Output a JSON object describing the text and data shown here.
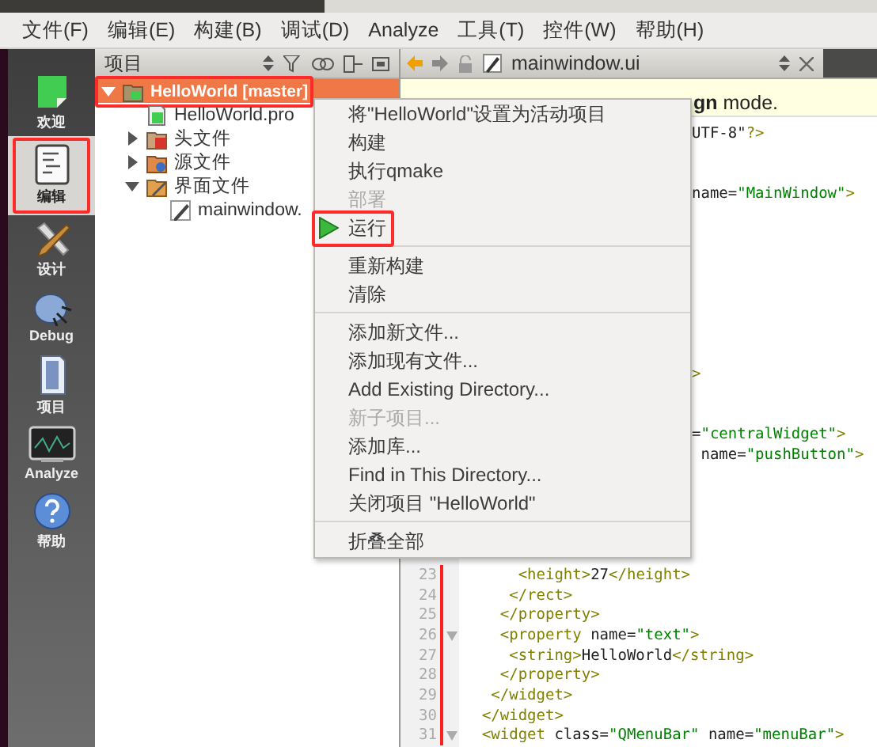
{
  "menubar": {
    "items": [
      "文件(F)",
      "编辑(E)",
      "构建(B)",
      "调试(D)",
      "Analyze",
      "工具(T)",
      "控件(W)",
      "帮助(H)"
    ]
  },
  "modes": [
    {
      "label": "欢迎",
      "kind": "welcome",
      "selected": false,
      "outlined": false
    },
    {
      "label": "编辑",
      "kind": "edit",
      "selected": true,
      "outlined": true
    },
    {
      "label": "设计",
      "kind": "design",
      "selected": false,
      "outlined": false
    },
    {
      "label": "Debug",
      "kind": "debug",
      "selected": false,
      "outlined": false
    },
    {
      "label": "项目",
      "kind": "projects",
      "selected": false,
      "outlined": false
    },
    {
      "label": "Analyze",
      "kind": "analyze",
      "selected": false,
      "outlined": false
    },
    {
      "label": "帮助",
      "kind": "help",
      "selected": false,
      "outlined": false
    }
  ],
  "project_panel": {
    "title": "项目",
    "tree": [
      {
        "label": "HelloWorld [master]",
        "kind": "project",
        "expanded": true,
        "selected": true,
        "outlined": true,
        "children": [
          {
            "label": "HelloWorld.pro",
            "kind": "pro",
            "selected": false,
            "outlined": false
          },
          {
            "label": "头文件",
            "kind": "headers",
            "expanded": false,
            "selected": false,
            "outlined": false
          },
          {
            "label": "源文件",
            "kind": "sources",
            "expanded": false,
            "selected": false,
            "outlined": false
          },
          {
            "label": "界面文件",
            "kind": "forms",
            "expanded": true,
            "selected": false,
            "outlined": false,
            "children": [
              {
                "label": "mainwindow.",
                "kind": "form",
                "selected": false,
                "outlined": false
              }
            ]
          }
        ]
      }
    ]
  },
  "editor": {
    "tab": {
      "title": "mainwindow.ui"
    },
    "info_bar": {
      "text": "**gn** mode."
    },
    "lines": [
      {
        "kind": "fragment",
        "segments": [
          {
            "kind": "plain",
            "text": "UTF-8\""
          },
          {
            "kind": "tag",
            "text": "?>"
          }
        ]
      },
      {
        "kind": "covered"
      },
      {
        "kind": "covered"
      },
      {
        "kind": "fragment",
        "segments": [
          {
            "kind": "plain",
            "text": "name="
          },
          {
            "kind": "value",
            "text": "\"MainWindow\""
          },
          {
            "kind": "tag",
            "text": ">"
          }
        ]
      },
      {
        "kind": "covered"
      },
      {
        "kind": "covered"
      },
      {
        "kind": "covered"
      },
      {
        "kind": "covered"
      },
      {
        "kind": "covered"
      },
      {
        "kind": "covered"
      },
      {
        "kind": "covered"
      },
      {
        "kind": "covered"
      },
      {
        "kind": "fragment",
        "segments": [
          {
            "kind": "tag",
            "text": ">"
          }
        ]
      },
      {
        "kind": "covered"
      },
      {
        "kind": "covered"
      },
      {
        "kind": "fragment",
        "segments": [
          {
            "kind": "plain",
            "text": "="
          },
          {
            "kind": "value",
            "text": "\"centralWidget\""
          },
          {
            "kind": "tag",
            "text": ">"
          }
        ]
      },
      {
        "kind": "fragment",
        "segments": [
          {
            "kind": "plain",
            "text": " name="
          },
          {
            "kind": "value",
            "text": "\"pushButton\""
          },
          {
            "kind": "tag",
            "text": ">"
          }
        ]
      },
      {
        "kind": "covered"
      },
      {
        "kind": "covered"
      },
      {
        "kind": "covered"
      },
      {
        "kind": "covered"
      },
      {
        "kind": "covered"
      },
      {
        "kind": "code",
        "number": "23",
        "fold": false,
        "segments": [
          {
            "kind": "tag",
            "text": "      <height>"
          },
          {
            "kind": "plain",
            "text": "27"
          },
          {
            "kind": "tag",
            "text": "</height>"
          }
        ]
      },
      {
        "kind": "code",
        "number": "24",
        "fold": false,
        "segments": [
          {
            "kind": "tag",
            "text": "     </rect>"
          }
        ]
      },
      {
        "kind": "code",
        "number": "25",
        "fold": false,
        "segments": [
          {
            "kind": "tag",
            "text": "    </property>"
          }
        ]
      },
      {
        "kind": "code",
        "number": "26",
        "fold": true,
        "segments": [
          {
            "kind": "tag",
            "text": "    <property "
          },
          {
            "kind": "plain",
            "text": "name="
          },
          {
            "kind": "value",
            "text": "\"text\""
          },
          {
            "kind": "tag",
            "text": ">"
          }
        ]
      },
      {
        "kind": "code",
        "number": "27",
        "fold": false,
        "segments": [
          {
            "kind": "tag",
            "text": "     <string>"
          },
          {
            "kind": "plain",
            "text": "HelloWorld"
          },
          {
            "kind": "tag",
            "text": "</string>"
          }
        ]
      },
      {
        "kind": "code",
        "number": "28",
        "fold": false,
        "segments": [
          {
            "kind": "tag",
            "text": "    </property>"
          }
        ]
      },
      {
        "kind": "code",
        "number": "29",
        "fold": false,
        "segments": [
          {
            "kind": "tag",
            "text": "   </widget>"
          }
        ]
      },
      {
        "kind": "code",
        "number": "30",
        "fold": false,
        "segments": [
          {
            "kind": "tag",
            "text": "  </widget>"
          }
        ]
      },
      {
        "kind": "code",
        "number": "31",
        "fold": true,
        "segments": [
          {
            "kind": "tag",
            "text": "  <widget "
          },
          {
            "kind": "plain",
            "text": "class="
          },
          {
            "kind": "value",
            "text": "\"QMenuBar\""
          },
          {
            "kind": "plain",
            "text": " name="
          },
          {
            "kind": "value",
            "text": "\"menuBar\""
          },
          {
            "kind": "tag",
            "text": ">"
          }
        ]
      }
    ]
  },
  "context_menu": {
    "items": [
      {
        "kind": "action",
        "label": "将\"HelloWorld\"设置为活动项目",
        "disabled": false,
        "outlined": false
      },
      {
        "kind": "action",
        "label": "构建",
        "disabled": false,
        "outlined": false
      },
      {
        "kind": "action",
        "label": "执行qmake",
        "disabled": false,
        "outlined": false
      },
      {
        "kind": "action",
        "label": "部署",
        "disabled": true,
        "outlined": false
      },
      {
        "kind": "action",
        "label": "运行",
        "disabled": false,
        "outlined": true,
        "run": true
      },
      {
        "kind": "separator"
      },
      {
        "kind": "action",
        "label": "重新构建",
        "disabled": false,
        "outlined": false
      },
      {
        "kind": "action",
        "label": "清除",
        "disabled": false,
        "outlined": false
      },
      {
        "kind": "separator"
      },
      {
        "kind": "action",
        "label": "添加新文件...",
        "disabled": false,
        "outlined": false
      },
      {
        "kind": "action",
        "label": "添加现有文件...",
        "disabled": false,
        "outlined": false
      },
      {
        "kind": "action",
        "label": "Add Existing Directory...",
        "disabled": false,
        "outlined": false
      },
      {
        "kind": "action",
        "label": "新子项目...",
        "disabled": true,
        "outlined": false
      },
      {
        "kind": "action",
        "label": "添加库...",
        "disabled": false,
        "outlined": false
      },
      {
        "kind": "action",
        "label": "Find in This Directory...",
        "disabled": false,
        "outlined": false
      },
      {
        "kind": "action",
        "label": "关闭项目 \"HelloWorld\"",
        "disabled": false,
        "outlined": false
      },
      {
        "kind": "separator"
      },
      {
        "kind": "action",
        "label": "折叠全部",
        "disabled": false,
        "outlined": false
      }
    ]
  }
}
